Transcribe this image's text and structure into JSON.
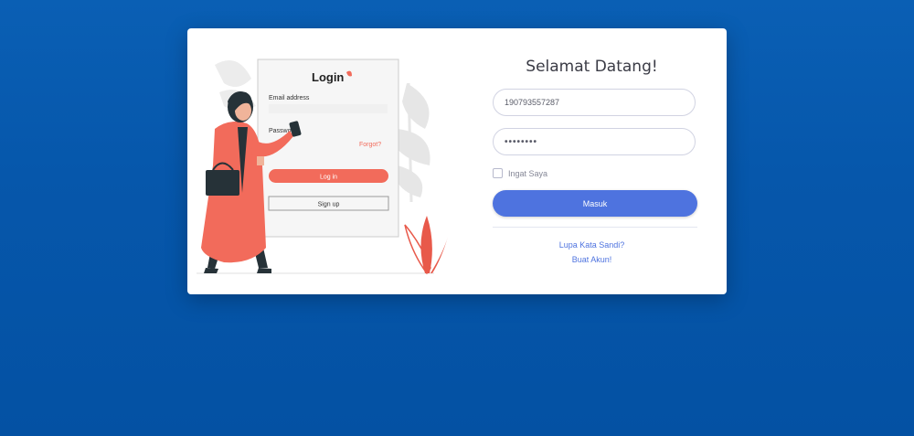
{
  "welcome_title": "Selamat Datang!",
  "username_value": "190793557287",
  "password_value": "••••••••",
  "remember_label": "Ingat Saya",
  "login_button": "Masuk",
  "forgot_link": "Lupa Kata Sandi?",
  "create_link": "Buat Akun!",
  "illustration": {
    "login_title": "Login",
    "email_label": "Email address",
    "password_label": "Password",
    "forgot_label": "Forgot?",
    "login_button": "Log in",
    "signup_button": "Sign up"
  },
  "colors": {
    "background": "#0657ab",
    "primary": "#4e73df",
    "accent": "#f26b5b"
  }
}
